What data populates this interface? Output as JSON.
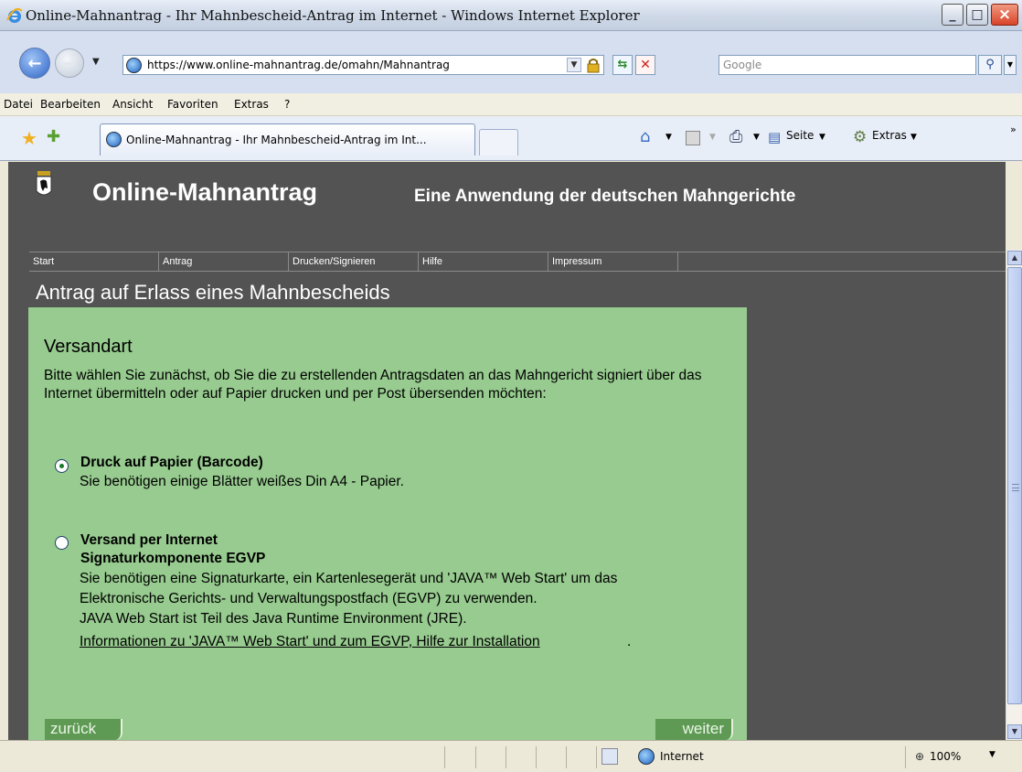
{
  "window": {
    "title": "Online-Mahnantrag - Ihr Mahnbescheid-Antrag im Internet - Windows Internet Explorer"
  },
  "address_bar": {
    "url": "https://www.online-mahnantrag.de/omahn/Mahnantrag",
    "search_placeholder": "Google"
  },
  "menu": {
    "items": [
      "Datei",
      "Bearbeiten",
      "Ansicht",
      "Favoriten",
      "Extras",
      "?"
    ]
  },
  "tabs": {
    "active_label": "Online-Mahnantrag - Ihr Mahnbescheid-Antrag im Int..."
  },
  "command_bar": {
    "page_label": "Seite",
    "tools_label": "Extras"
  },
  "site": {
    "title": "Online-Mahnantrag",
    "subtitle": "Eine Anwendung der deutschen Mahngerichte",
    "nav": [
      "Start",
      "Antrag",
      "Drucken/Signieren",
      "Hilfe",
      "Impressum"
    ],
    "heading": "Antrag auf Erlass eines Mahnbescheids"
  },
  "form": {
    "section_title": "Versandart",
    "intro": "Bitte wählen Sie zunächst, ob Sie die zu erstellenden Antragsdaten an das Mahngericht signiert über das Internet übermitteln oder auf Papier drucken und per Post übersenden möchten:",
    "options": [
      {
        "title": "Druck auf Papier (Barcode)",
        "subtitle": "",
        "lines": [
          "Sie benötigen einige Blätter weißes Din A4 - Papier."
        ],
        "selected": true
      },
      {
        "title": "Versand per Internet",
        "subtitle": "Signaturkomponente EGVP",
        "lines": [
          "Sie benötigen eine Signaturkarte, ein Kartenlesegerät und 'JAVA™ Web Start' um das",
          "Elektronische Gerichts- und Verwaltungspostfach (EGVP) zu verwenden.",
          "JAVA Web Start ist Teil des Java Runtime Environment (JRE)."
        ],
        "link": "Informationen zu 'JAVA™ Web Start' und zum EGVP, Hilfe zur Installation",
        "link_suffix": ".",
        "selected": false
      }
    ],
    "back_label": "zurück",
    "next_label": "weiter"
  },
  "status_bar": {
    "zone": "Internet",
    "zoom": "100%"
  },
  "icons": {
    "close": "close-icon",
    "back": "back-arrow-icon",
    "forward": "forward-arrow-icon",
    "home": "home-icon",
    "print": "print-icon",
    "favorites": "favorites-star-icon"
  },
  "colors": {
    "content_bg": "#535353",
    "panel_green": "#97cb8f",
    "button_green": "#5f9a55"
  }
}
